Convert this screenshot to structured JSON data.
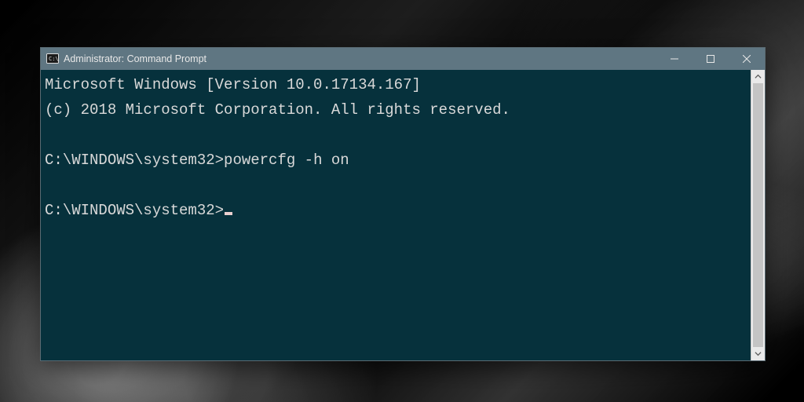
{
  "window": {
    "title": "Administrator: Command Prompt"
  },
  "console": {
    "line1": "Microsoft Windows [Version 10.0.17134.167]",
    "line2": "(c) 2018 Microsoft Corporation. All rights reserved.",
    "blank1": "",
    "prompt1_path": "C:\\WINDOWS\\system32>",
    "prompt1_cmd": "powercfg -h on",
    "blank2": "",
    "prompt2_path": "C:\\WINDOWS\\system32>"
  }
}
